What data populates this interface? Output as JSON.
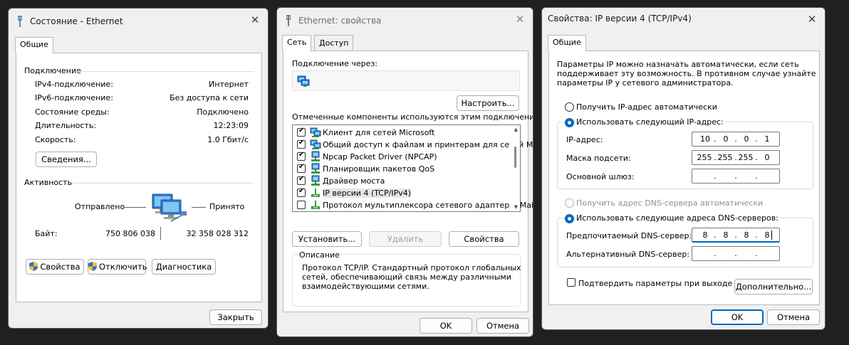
{
  "w1": {
    "title": "Состояние - Ethernet",
    "tab": "Общие",
    "connection_header": "Подключение",
    "rows": [
      {
        "label": "IPv4-подключение:",
        "value": "Интернет"
      },
      {
        "label": "IPv6-подключение:",
        "value": "Без доступа к сети"
      },
      {
        "label": "Состояние среды:",
        "value": "Подключено"
      },
      {
        "label": "Длительность:",
        "value": "12:23:09"
      },
      {
        "label": "Скорость:",
        "value": "1.0 Гбит/с"
      }
    ],
    "details_button": "Сведения...",
    "activity_header": "Активность",
    "sent_label": "Отправлено",
    "received_label": "Принято",
    "bytes_label": "Байт:",
    "bytes_sent": "750 806 038",
    "bytes_received": "32 358 028 312",
    "properties_button": "Свойства",
    "disable_button": "Отключить",
    "diagnose_button": "Диагностика",
    "close_button": "Закрыть"
  },
  "w2": {
    "title": "Ethernet: свойства",
    "tabs": [
      "Сеть",
      "Доступ"
    ],
    "connect_using": "Подключение через:",
    "configure_button": "Настроить...",
    "components_label": "Отмеченные компоненты используются этим подключением:",
    "items": [
      {
        "label": "Клиент для сетей Microsoft",
        "checked": true,
        "icon": "network-client-icon"
      },
      {
        "label": "Общий доступ к файлам и принтерам для сетей Mi",
        "checked": true,
        "icon": "network-client-icon"
      },
      {
        "label": "Npcap Packet Driver (NPCAP)",
        "checked": true,
        "icon": "network-service-icon"
      },
      {
        "label": "Планировщик пакетов QoS",
        "checked": true,
        "icon": "network-service-icon"
      },
      {
        "label": "Драйвер моста",
        "checked": true,
        "icon": "network-service-icon"
      },
      {
        "label": "IP версии 4 (TCP/IPv4)",
        "checked": true,
        "icon": "protocol-icon"
      },
      {
        "label": "Протокол мультиплексора сетевого адаптера (Mai",
        "checked": false,
        "icon": "protocol-icon"
      }
    ],
    "install_button": "Установить...",
    "remove_button": "Удалить",
    "properties_button": "Свойства",
    "description_header": "Описание",
    "description_text": [
      "Протокол TCP/IP. Стандартный протокол глобальных",
      "сетей, обеспечивающий связь между различными",
      "взаимодействующими сетями."
    ],
    "ok_button": "OK",
    "cancel_button": "Отмена"
  },
  "w3": {
    "title": "Свойства: IP версии 4 (TCP/IPv4)",
    "tab": "Общие",
    "intro": [
      "Параметры IP можно назначать автоматически, если сеть",
      "поддерживает эту возможность. В противном случае узнайте",
      "параметры IP у сетевого администратора."
    ],
    "auto_ip": "Получить IP-адрес автоматически",
    "manual_ip": "Использовать следующий IP-адрес:",
    "ip_label": "IP-адрес:",
    "ip": [
      "10",
      "0",
      "0",
      "1"
    ],
    "mask_label": "Маска подсети:",
    "mask": [
      "255",
      "255",
      "255",
      "0"
    ],
    "gateway_label": "Основной шлюз:",
    "gateway": [
      "",
      "",
      "",
      ""
    ],
    "auto_dns": "Получить адрес DNS-сервера автоматически",
    "manual_dns": "Использовать следующие адреса DNS-серверов:",
    "pref_dns_label": "Предпочитаемый DNS-сервер:",
    "pref_dns": [
      "8",
      "8",
      "8",
      "8"
    ],
    "alt_dns_label": "Альтернативный DNS-сервер:",
    "alt_dns": [
      "",
      "",
      "",
      ""
    ],
    "validate_label": "Подтвердить параметры при выходе",
    "advanced_button": "Дополнительно...",
    "ok_button": "OK",
    "cancel_button": "Отмена"
  },
  "colors": {
    "accent": "#0067c0",
    "desktop": "#202020",
    "window": "#f0f0f0"
  }
}
